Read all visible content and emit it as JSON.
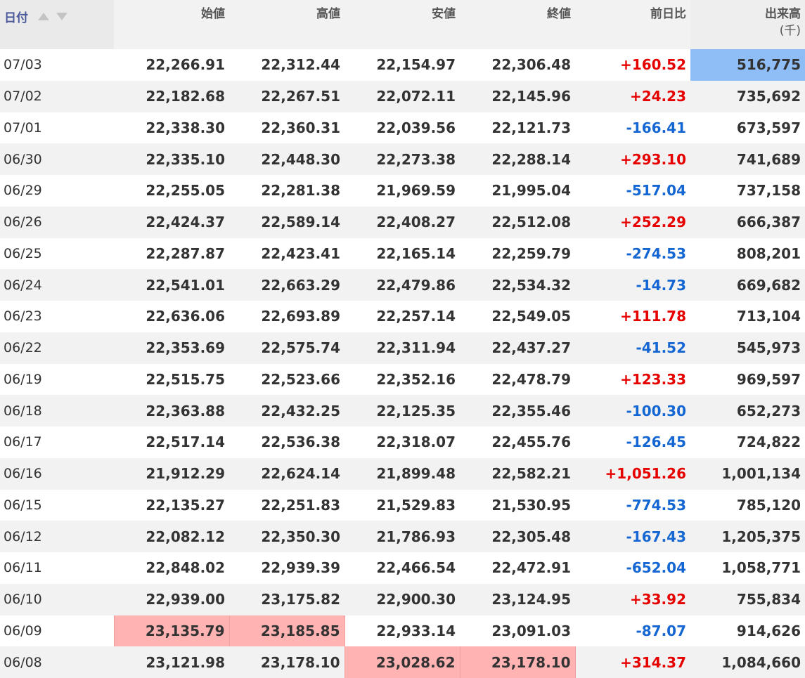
{
  "header": {
    "date": "日付",
    "open": "始値",
    "high": "高値",
    "low": "安値",
    "close": "終値",
    "change": "前日比",
    "volume": "出来高",
    "volume_unit": "(千)"
  },
  "colors": {
    "up": "#e60000",
    "down": "#1466d2",
    "highlight_red": "#ffb3b3",
    "highlight_blue": "#8ebef5"
  },
  "rows": [
    {
      "date": "07/03",
      "open": "22,266.91",
      "high": "22,312.44",
      "low": "22,154.97",
      "close": "22,306.48",
      "change": "+160.52",
      "volume": "516,775"
    },
    {
      "date": "07/02",
      "open": "22,182.68",
      "high": "22,267.51",
      "low": "22,072.11",
      "close": "22,145.96",
      "change": "+24.23",
      "volume": "735,692"
    },
    {
      "date": "07/01",
      "open": "22,338.30",
      "high": "22,360.31",
      "low": "22,039.56",
      "close": "22,121.73",
      "change": "-166.41",
      "volume": "673,597"
    },
    {
      "date": "06/30",
      "open": "22,335.10",
      "high": "22,448.30",
      "low": "22,273.38",
      "close": "22,288.14",
      "change": "+293.10",
      "volume": "741,689"
    },
    {
      "date": "06/29",
      "open": "22,255.05",
      "high": "22,281.38",
      "low": "21,969.59",
      "close": "21,995.04",
      "change": "-517.04",
      "volume": "737,158"
    },
    {
      "date": "06/26",
      "open": "22,424.37",
      "high": "22,589.14",
      "low": "22,408.27",
      "close": "22,512.08",
      "change": "+252.29",
      "volume": "666,387"
    },
    {
      "date": "06/25",
      "open": "22,287.87",
      "high": "22,423.41",
      "low": "22,165.14",
      "close": "22,259.79",
      "change": "-274.53",
      "volume": "808,201"
    },
    {
      "date": "06/24",
      "open": "22,541.01",
      "high": "22,663.29",
      "low": "22,479.86",
      "close": "22,534.32",
      "change": "-14.73",
      "volume": "669,682"
    },
    {
      "date": "06/23",
      "open": "22,636.06",
      "high": "22,693.89",
      "low": "22,257.14",
      "close": "22,549.05",
      "change": "+111.78",
      "volume": "713,104"
    },
    {
      "date": "06/22",
      "open": "22,353.69",
      "high": "22,575.74",
      "low": "22,311.94",
      "close": "22,437.27",
      "change": "-41.52",
      "volume": "545,973"
    },
    {
      "date": "06/19",
      "open": "22,515.75",
      "high": "22,523.66",
      "low": "22,352.16",
      "close": "22,478.79",
      "change": "+123.33",
      "volume": "969,597"
    },
    {
      "date": "06/18",
      "open": "22,363.88",
      "high": "22,432.25",
      "low": "22,125.35",
      "close": "22,355.46",
      "change": "-100.30",
      "volume": "652,273"
    },
    {
      "date": "06/17",
      "open": "22,517.14",
      "high": "22,536.38",
      "low": "22,318.07",
      "close": "22,455.76",
      "change": "-126.45",
      "volume": "724,822"
    },
    {
      "date": "06/16",
      "open": "21,912.29",
      "high": "22,624.14",
      "low": "21,899.48",
      "close": "22,582.21",
      "change": "+1,051.26",
      "volume": "1,001,134"
    },
    {
      "date": "06/15",
      "open": "22,135.27",
      "high": "22,251.83",
      "low": "21,529.83",
      "close": "21,530.95",
      "change": "-774.53",
      "volume": "785,120"
    },
    {
      "date": "06/12",
      "open": "22,082.12",
      "high": "22,350.30",
      "low": "21,786.93",
      "close": "22,305.48",
      "change": "-167.43",
      "volume": "1,205,375"
    },
    {
      "date": "06/11",
      "open": "22,848.02",
      "high": "22,939.39",
      "low": "22,466.54",
      "close": "22,472.91",
      "change": "-652.04",
      "volume": "1,058,771"
    },
    {
      "date": "06/10",
      "open": "22,939.00",
      "high": "23,175.82",
      "low": "22,900.30",
      "close": "23,124.95",
      "change": "+33.92",
      "volume": "755,834"
    },
    {
      "date": "06/09",
      "open": "23,135.79",
      "high": "23,185.85",
      "low": "22,933.14",
      "close": "23,091.03",
      "change": "-87.07",
      "volume": "914,626"
    },
    {
      "date": "06/08",
      "open": "23,121.98",
      "high": "23,178.10",
      "low": "23,028.62",
      "close": "23,178.10",
      "change": "+314.37",
      "volume": "1,084,660"
    }
  ]
}
